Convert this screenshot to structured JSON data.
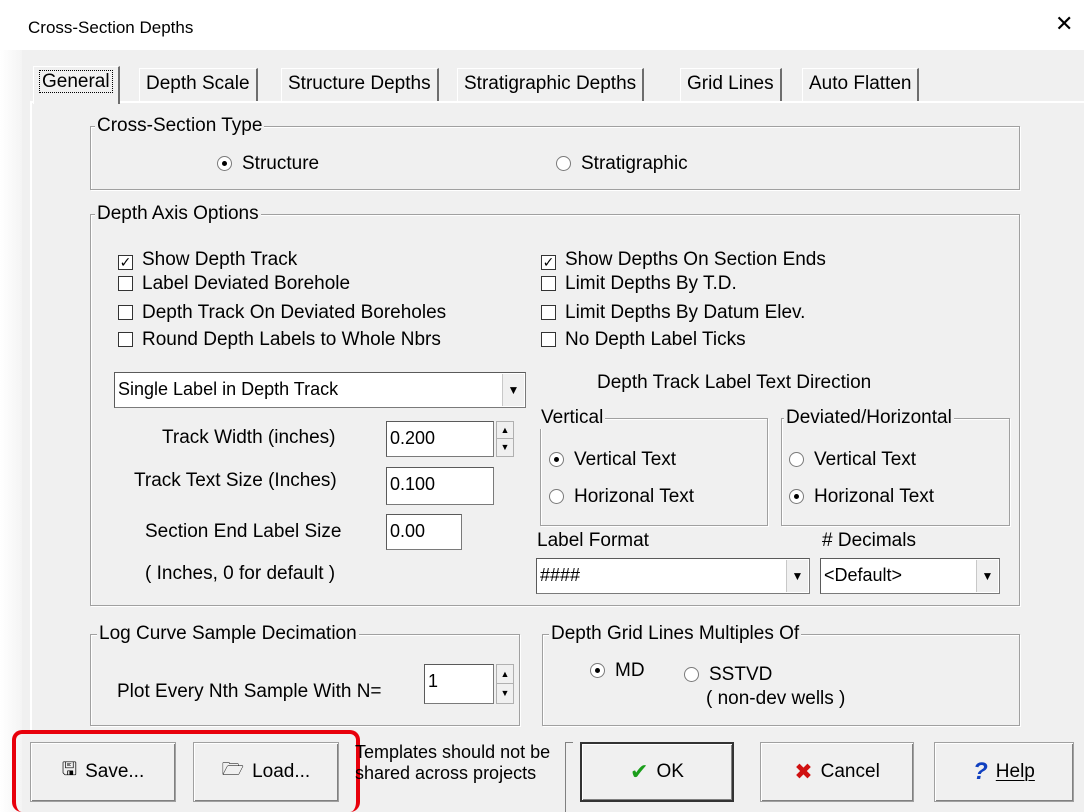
{
  "window": {
    "title": "Cross-Section Depths",
    "close_glyph": "✕"
  },
  "tabs": [
    {
      "label": "General",
      "active": true
    },
    {
      "label": "Depth Scale"
    },
    {
      "label": "Structure Depths"
    },
    {
      "label": "Stratigraphic Depths"
    },
    {
      "label": "Grid Lines"
    },
    {
      "label": "Auto Flatten"
    }
  ],
  "cross_section_type": {
    "title": "Cross-Section Type",
    "options": [
      {
        "label": "Structure",
        "selected": true
      },
      {
        "label": "Stratigraphic",
        "selected": false
      }
    ]
  },
  "depth_axis": {
    "title": "Depth Axis Options",
    "checks_left": [
      {
        "label": "Show Depth Track",
        "checked": true
      },
      {
        "label": "Label Deviated Borehole",
        "checked": false
      },
      {
        "label": "Depth Track On Deviated Boreholes",
        "checked": false
      },
      {
        "label": "Round Depth Labels to Whole Nbrs",
        "checked": false
      }
    ],
    "checks_right": [
      {
        "label": "Show Depths On Section Ends",
        "checked": true
      },
      {
        "label": "Limit Depths By T.D.",
        "checked": false
      },
      {
        "label": "Limit Depths By Datum Elev.",
        "checked": false
      },
      {
        "label": "No Depth Label Ticks",
        "checked": false
      }
    ],
    "label_mode": "Single Label in Depth Track",
    "track_width_label": "Track Width (inches)",
    "track_width": "0.200",
    "track_text_size_label": "Track Text Size (Inches)",
    "track_text_size": "0.100",
    "section_end_label": "Section End Label Size",
    "section_end_size": "0.00",
    "section_end_hint": "( Inches, 0 for default )",
    "text_direction_label": "Depth Track Label Text Direction",
    "vertical_group": {
      "title": "Vertical",
      "options": [
        {
          "label": "Vertical Text",
          "selected": true
        },
        {
          "label": "Horizonal Text",
          "selected": false
        }
      ]
    },
    "deviated_group": {
      "title": "Deviated/Horizontal",
      "options": [
        {
          "label": "Vertical Text",
          "selected": false
        },
        {
          "label": "Horizonal Text",
          "selected": true
        }
      ]
    },
    "label_format_label": "Label Format",
    "label_format": "####",
    "decimals_label": "# Decimals",
    "decimals": "<Default>"
  },
  "decimation": {
    "title": "Log Curve Sample Decimation",
    "label": "Plot Every Nth Sample With N=",
    "value": "1"
  },
  "grid_multiples": {
    "title": "Depth Grid Lines Multiples Of",
    "md_label": "MD",
    "sstvd_label": "SSTVD",
    "sstvd_hint": "( non-dev wells )"
  },
  "buttons": {
    "save": "Save...",
    "load": "Load...",
    "template_note": "Templates should not be shared across projects",
    "ok": "OK",
    "cancel": "Cancel",
    "help": "Help",
    "ok_glyph": "✔",
    "cancel_glyph": "✖",
    "help_glyph": "?"
  },
  "colors": {
    "ok_check": "#1a9e1a",
    "cancel_x": "#d01010",
    "help_q": "#1040c0",
    "highlight": "#e8000b"
  }
}
